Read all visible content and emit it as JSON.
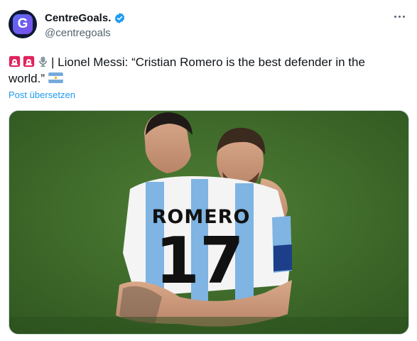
{
  "account": {
    "display_name": "CentreGoals.",
    "handle": "@centregoals",
    "avatar_letter": "G"
  },
  "tweet": {
    "emoji_prefix": [
      "siren-emoji",
      "siren-emoji",
      "microphone-emoji"
    ],
    "text_line_1": "| Lionel Messi: “Cristian Romero is the best defender in the",
    "text_line_2": "world.”",
    "trailing_emoji": "argentina-flag-emoji",
    "translate_label": "Post übersetzen"
  },
  "media": {
    "jersey_name": "ROMERO",
    "jersey_number": "17"
  },
  "colors": {
    "accent": "#1d9bf0",
    "verified": "#1d9bf0",
    "pitch": "#3d6a2a"
  }
}
